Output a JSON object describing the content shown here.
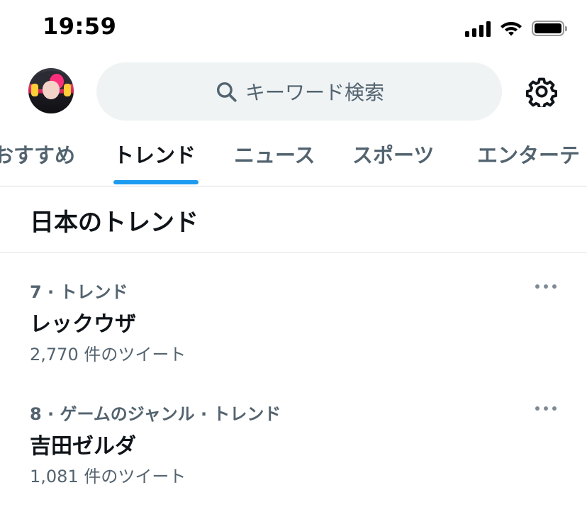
{
  "status_bar": {
    "time": "19:59"
  },
  "header": {
    "search": {
      "placeholder": "キーワード検索",
      "icon": "search-icon"
    },
    "settings_icon": "gear-icon"
  },
  "tabs": [
    {
      "label": "おすすめ",
      "active": false
    },
    {
      "label": "トレンド",
      "active": true
    },
    {
      "label": "ニュース",
      "active": false
    },
    {
      "label": "スポーツ",
      "active": false
    },
    {
      "label": "エンターテ",
      "active": false
    }
  ],
  "section": {
    "title": "日本のトレンド"
  },
  "trends": [
    {
      "meta": "7 · トレンド",
      "name": "レックウザ",
      "count": "2,770 件のツイート"
    },
    {
      "meta": "8 · ゲームのジャンル · トレンド",
      "name": "吉田ゼルダ",
      "count": "1,081 件のツイート"
    }
  ],
  "colors": {
    "accent": "#1d9bf0",
    "text_primary": "#0f1419",
    "text_secondary": "#536471",
    "search_bg": "#eff3f4"
  }
}
